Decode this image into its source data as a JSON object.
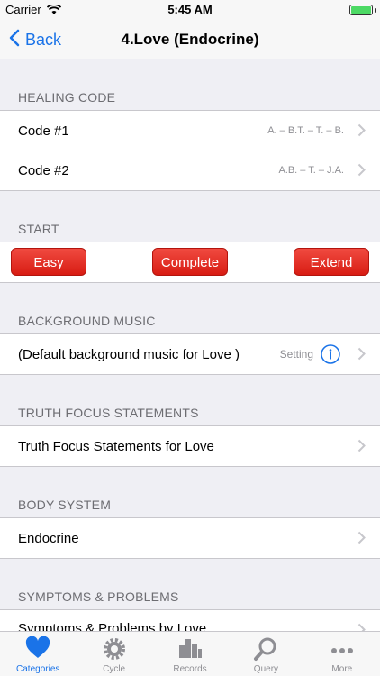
{
  "status_bar": {
    "carrier": "Carrier",
    "time": "5:45 AM"
  },
  "nav": {
    "back_label": "Back",
    "title": "4.Love (Endocrine)"
  },
  "sections": {
    "healing_code": {
      "header": "HEALING CODE",
      "rows": [
        {
          "label": "Code #1",
          "detail": "A. – B.T. – T. – B."
        },
        {
          "label": "Code #2",
          "detail": "A.B. – T. – J.A."
        }
      ]
    },
    "start": {
      "header": "START",
      "buttons": {
        "easy": "Easy",
        "complete": "Complete",
        "extend": "Extend"
      }
    },
    "background_music": {
      "header": "BACKGROUND MUSIC",
      "row_label": "(Default background music for Love )",
      "setting_label": "Setting"
    },
    "truth_focus": {
      "header": "TRUTH FOCUS STATEMENTS",
      "row_label": "Truth Focus Statements for Love"
    },
    "body_system": {
      "header": "BODY SYSTEM",
      "row_label": "Endocrine"
    },
    "symptoms": {
      "header": "SYMPTOMS & PROBLEMS",
      "row_label": "Symptoms & Problems by Love"
    }
  },
  "tabs": [
    {
      "label": "Categories",
      "icon": "heart-icon",
      "active": true
    },
    {
      "label": "Cycle",
      "icon": "gear-icon",
      "active": false
    },
    {
      "label": "Records",
      "icon": "bar-chart-icon",
      "active": false
    },
    {
      "label": "Query",
      "icon": "search-icon",
      "active": false
    },
    {
      "label": "More",
      "icon": "more-icon",
      "active": false
    }
  ],
  "colors": {
    "accent": "#1a73e8",
    "button_red": "#e0261c",
    "battery": "#4cd964"
  }
}
